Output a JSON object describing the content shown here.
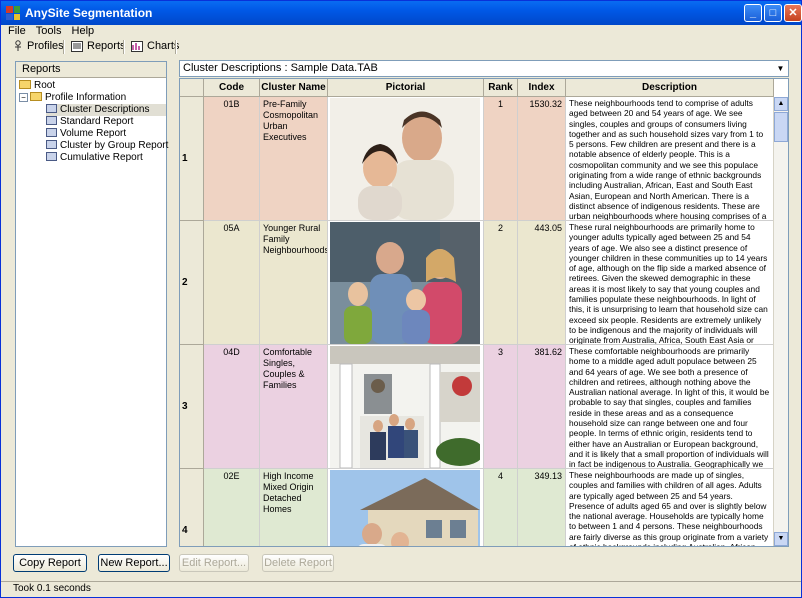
{
  "window": {
    "title": "AnySite Segmentation"
  },
  "menu": [
    "File",
    "Tools",
    "Help"
  ],
  "toolbar": {
    "profiles": "Profiles",
    "reports": "Reports",
    "charts": "Charts"
  },
  "reports_panel": {
    "header": "Reports",
    "root": "Root",
    "group": "Profile Information",
    "items": [
      "Cluster Descriptions",
      "Standard Report",
      "Volume Report",
      "Cluster by Group Report",
      "Cumulative Report"
    ],
    "selected": "Cluster Descriptions"
  },
  "report_selector": {
    "value": "Cluster Descriptions : Sample Data.TAB"
  },
  "table": {
    "columns": [
      "Code",
      "Cluster Name",
      "Pictorial",
      "Rank",
      "Index",
      "Description"
    ],
    "sort_indicator": "▲",
    "rows": [
      {
        "row": "1",
        "code": "01B",
        "name": "Pre-Family Cosmopolitan Urban Executives",
        "rank": "1",
        "index": "1530.32",
        "color": "#efd3c3",
        "description": "These neighbourhoods tend to comprise of adults aged between 20 and 54 years of age. We see singles, couples and groups of consumers living together and as such household sizes vary from 1 to 5 persons. Few children are present and there is a notable absence of elderly people. This is a cosmopolitan community and we see this populace originating from a wide range of ethnic backgrounds including Australian, African, East and South East Asian, European and North American. There is a distinct absence of indigenous residents. These are urban neighbourhoods where housing comprises of a mix of semi-detached properties and apartments. Tenure patterns are also mixed and as well as seeing those who"
      },
      {
        "row": "2",
        "code": "05A",
        "name": "Younger Rural Family Neighbourhoods",
        "rank": "2",
        "index": "443.05",
        "color": "#ebe7cf",
        "description": "These rural neighbourhoods are primarily home to younger adults typically aged between 25 and 54 years of age. We also see a distinct presence of younger children in these communities up to 14 years of age, although on the flip side a marked absence of retirees. Given the skewed demographic in these areas it is most likely to say that young couples and families populate these neighbourhoods. In light of this, it is unsurprising to learn that household size can exceed six people. Residents are extremely unlikely to be indigenous and the majority of individuals will originate from Australia, Africa, South East Asia or South Asia. Geographically these communities are distributed in rural areas. Properties are generally"
      },
      {
        "row": "3",
        "code": "04D",
        "name": "Comfortable Singles, Couples & Families",
        "rank": "3",
        "index": "381.62",
        "color": "#ebd1e1",
        "description": "These comfortable neighbourhoods are primarily home to a middle aged adult populace between 25 and 64 years of age. We see both a presence of children and retirees, although nothing above the Australian national average. In light of this, it would be probable to say that singles, couples and families reside in these areas and as a consequence household size can range between one and four people. In terms of ethnic origin, residents tend to either have an Australian or European background, and it is likely that a small proportion of individuals will in fact be indigenous to Australia. Geographically we see no fixed pattern in terms of the distribution of these neighbourhoods. Housing type also fluctuates significantly"
      },
      {
        "row": "4",
        "code": "02E",
        "name": "High Income Mixed Origin Detached Homes",
        "rank": "4",
        "index": "349.13",
        "color": "#dfe9d2",
        "description": "These neighbourhoods are made up of singles, couples and families with children of all ages. Adults are typically aged between 25 and 54 years. Presence of adults aged 65 and over is slightly below the national average. Households are typically home to between 1 and 4 persons. These neighbourhoods are fairly diverse as this group originate from a variety of ethnic backgrounds including Australian, African, European, Middle Eastern and South Asian. Although in the main these"
      }
    ]
  },
  "buttons": {
    "copy": "Copy Report",
    "new": "New Report...",
    "edit": "Edit Report...",
    "delete": "Delete Report"
  },
  "status": "Took 0.1 seconds"
}
